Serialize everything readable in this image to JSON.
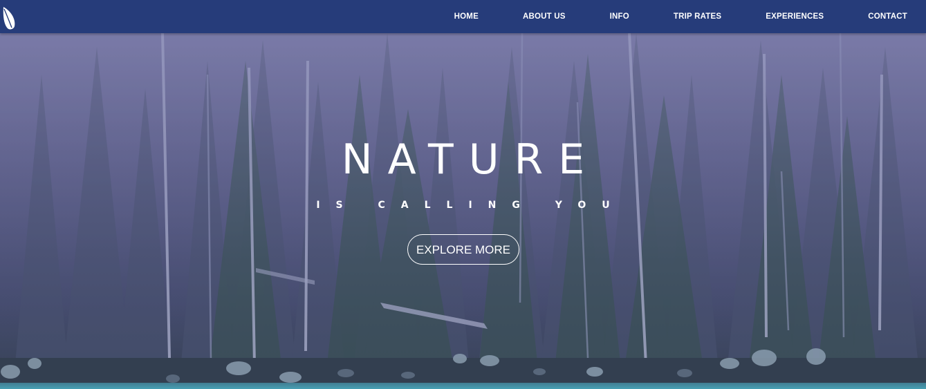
{
  "nav": {
    "logo_icon": "leaf-icon",
    "links": [
      {
        "label": "HOME"
      },
      {
        "label": "ABOUT US"
      },
      {
        "label": "INFO"
      },
      {
        "label": "TRIP RATES"
      },
      {
        "label": "EXPERIENCES"
      },
      {
        "label": "CONTACT"
      }
    ]
  },
  "hero": {
    "title": "NATURE",
    "subtitle": "IS CALLING YOU",
    "cta_label": "EXPLORE MORE",
    "background": "misty-forest-lake"
  },
  "colors": {
    "navbar": "#263c7a",
    "text": "#ffffff",
    "overlay": "#6e69a5",
    "water": "#3fb3c0"
  }
}
